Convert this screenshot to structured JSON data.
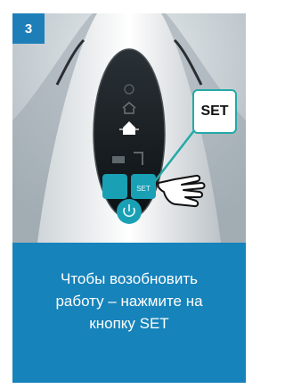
{
  "step": {
    "number": "3"
  },
  "panel": {
    "callout_label": "SET",
    "buttons": [
      "power-icon",
      "steam-icon",
      "home-icon",
      "water-icon",
      "iron-icon",
      "tap-icon",
      "ok-icon",
      "set-button",
      "power-button"
    ]
  },
  "caption": {
    "lines": [
      "Чтобы возобновить",
      "работу – нажмите на",
      "кнопку SET"
    ]
  },
  "colors": {
    "card": "#1683bb",
    "accent": "#23a9a8",
    "panel": "#151a1d"
  }
}
